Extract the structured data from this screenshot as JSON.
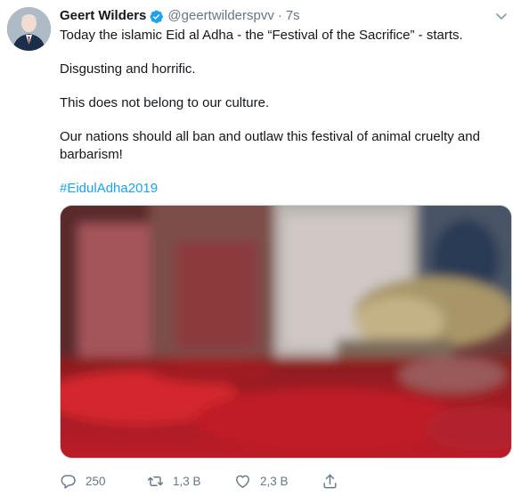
{
  "tweet": {
    "author_name": "Geert Wilders",
    "handle": "@geertwilderspvv",
    "separator": "·",
    "time": "7s",
    "lines": [
      "Today the islamic Eid al Adha - the “Festival of the Sacrifice” - starts.",
      "Disgusting and horrific.",
      "This does not belong to our culture.",
      "Our nations should all ban and outlaw this festival of animal cruelty and barbarism!"
    ],
    "hashtag": "#EidulAdha2019",
    "stats": {
      "replies": "250",
      "retweets": "1,3 B",
      "likes": "2,3 B"
    }
  },
  "icons": {
    "verified": "verified-badge-icon",
    "caret": "chevron-down-icon",
    "reply": "reply-icon",
    "retweet": "retweet-icon",
    "like": "heart-icon",
    "share": "share-icon"
  },
  "colors": {
    "link": "#1da1f2",
    "muted": "#657786",
    "text": "#14171a"
  }
}
